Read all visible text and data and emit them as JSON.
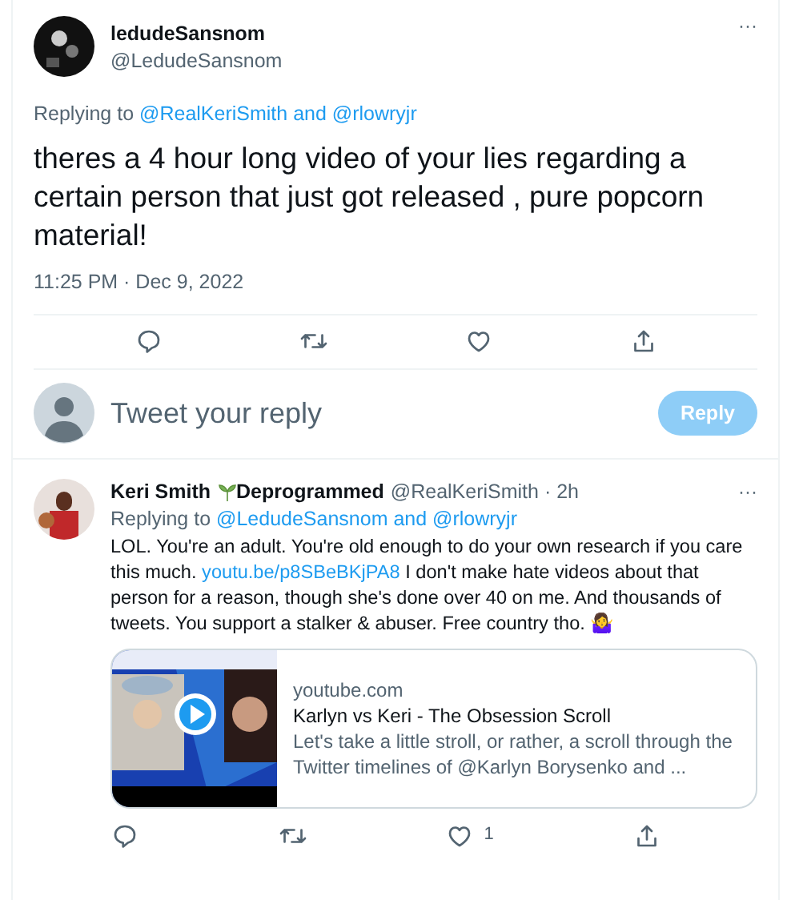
{
  "main_tweet": {
    "name": "ledudeSansnom",
    "handle": "@LedudeSansnom",
    "replying_label": "Replying to",
    "replying_to": "@RealKeriSmith and @rlowryjr",
    "text": "theres a 4 hour long video of your lies regarding a certain person that just got released , pure popcorn material!",
    "timestamp": "11:25 PM · Dec 9, 2022",
    "more": "···"
  },
  "reply_box": {
    "placeholder": "Tweet your reply",
    "button": "Reply",
    "disabled": true
  },
  "reply": {
    "name": "Keri Smith",
    "name_suffix": "Deprogrammed",
    "handle": "@RealKeriSmith · 2h",
    "more": "···",
    "replying_label": "Replying to",
    "replying_to": "@LedudeSansnom and @rlowryjr",
    "text_before": "LOL. You're an adult. You're old enough to do your own research if you care this much.",
    "link": "youtu.be/p8SBeBKjPA8",
    "text_after": "I don't make hate videos about that person for a reason, though she's done over 40 on me. And thousands of tweets. You support a stalker & abuser. Free country tho. 🤷‍♀️",
    "card": {
      "kind": "picture",
      "domain": "youtube.com",
      "title": "Karlyn vs Keri - The Obsession Scroll",
      "description": "Let's take a little stroll, or rather, a scroll through the Twitter timelines of @Karlyn Borysenko and ..."
    },
    "like_count": "1"
  }
}
